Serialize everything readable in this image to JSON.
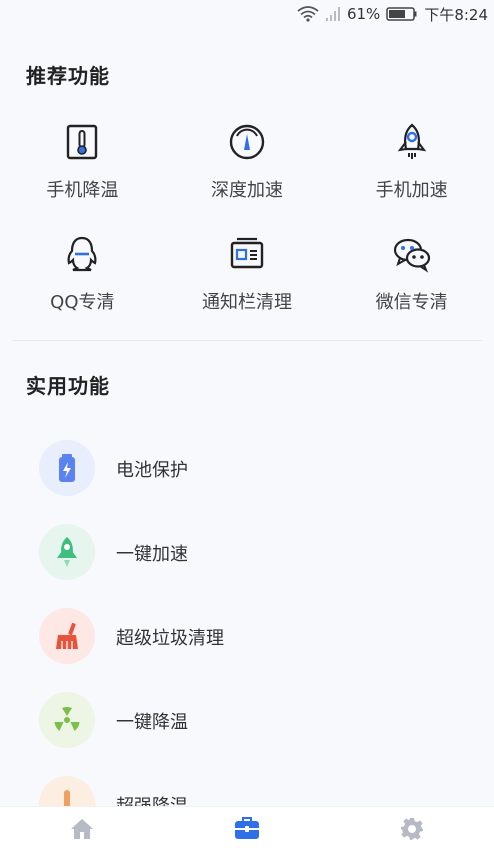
{
  "status_bar": {
    "battery": "61%",
    "time": "下午8:24"
  },
  "recommended": {
    "title": "推荐功能",
    "items": [
      {
        "label": "手机降温",
        "icon": "thermometer-icon"
      },
      {
        "label": "深度加速",
        "icon": "speedometer-icon"
      },
      {
        "label": "手机加速",
        "icon": "rocket-icon"
      },
      {
        "label": "QQ专清",
        "icon": "qq-penguin-icon"
      },
      {
        "label": "通知栏清理",
        "icon": "notification-card-icon"
      },
      {
        "label": "微信专清",
        "icon": "wechat-icon"
      }
    ]
  },
  "practical": {
    "title": "实用功能",
    "items": [
      {
        "label": "电池保护",
        "icon": "battery-icon",
        "bg": "#e8eefc",
        "color": "#5b82f0"
      },
      {
        "label": "一键加速",
        "icon": "rocket-icon",
        "bg": "#e6f6ee",
        "color": "#3fbf7f"
      },
      {
        "label": "超级垃圾清理",
        "icon": "broom-icon",
        "bg": "#fde8e6",
        "color": "#e8533c"
      },
      {
        "label": "一键降温",
        "icon": "fan-icon",
        "bg": "#edf5e4",
        "color": "#7cc04a"
      },
      {
        "label": "超强降温",
        "icon": "thermometer-icon",
        "bg": "#fdeee2",
        "color": "#f0a060"
      }
    ]
  },
  "tabs": [
    {
      "name": "home",
      "icon": "home-icon",
      "active": false
    },
    {
      "name": "toolbox",
      "icon": "toolbox-icon",
      "active": true
    },
    {
      "name": "settings",
      "icon": "gear-icon",
      "active": false
    }
  ],
  "colors": {
    "accent": "#2f6fe8",
    "inactive_tab": "#b5bac4"
  }
}
